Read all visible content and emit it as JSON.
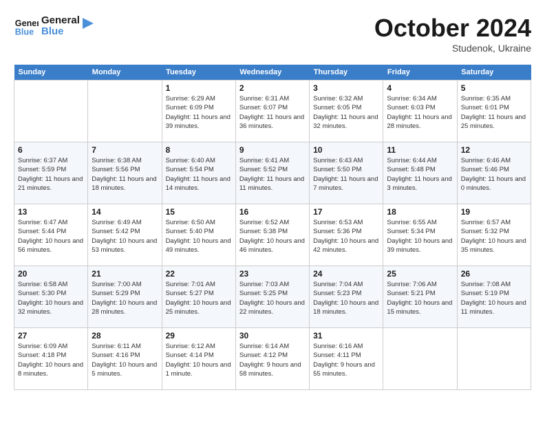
{
  "header": {
    "logo": "GeneralBlue",
    "month": "October 2024",
    "location": "Studenok, Ukraine"
  },
  "days_of_week": [
    "Sunday",
    "Monday",
    "Tuesday",
    "Wednesday",
    "Thursday",
    "Friday",
    "Saturday"
  ],
  "weeks": [
    {
      "cells": [
        {
          "day": null,
          "content": null
        },
        {
          "day": null,
          "content": null
        },
        {
          "day": "1",
          "content": "Sunrise: 6:29 AM\nSunset: 6:09 PM\nDaylight: 11 hours and 39 minutes."
        },
        {
          "day": "2",
          "content": "Sunrise: 6:31 AM\nSunset: 6:07 PM\nDaylight: 11 hours and 36 minutes."
        },
        {
          "day": "3",
          "content": "Sunrise: 6:32 AM\nSunset: 6:05 PM\nDaylight: 11 hours and 32 minutes."
        },
        {
          "day": "4",
          "content": "Sunrise: 6:34 AM\nSunset: 6:03 PM\nDaylight: 11 hours and 28 minutes."
        },
        {
          "day": "5",
          "content": "Sunrise: 6:35 AM\nSunset: 6:01 PM\nDaylight: 11 hours and 25 minutes."
        }
      ]
    },
    {
      "cells": [
        {
          "day": "6",
          "content": "Sunrise: 6:37 AM\nSunset: 5:59 PM\nDaylight: 11 hours and 21 minutes."
        },
        {
          "day": "7",
          "content": "Sunrise: 6:38 AM\nSunset: 5:56 PM\nDaylight: 11 hours and 18 minutes."
        },
        {
          "day": "8",
          "content": "Sunrise: 6:40 AM\nSunset: 5:54 PM\nDaylight: 11 hours and 14 minutes."
        },
        {
          "day": "9",
          "content": "Sunrise: 6:41 AM\nSunset: 5:52 PM\nDaylight: 11 hours and 11 minutes."
        },
        {
          "day": "10",
          "content": "Sunrise: 6:43 AM\nSunset: 5:50 PM\nDaylight: 11 hours and 7 minutes."
        },
        {
          "day": "11",
          "content": "Sunrise: 6:44 AM\nSunset: 5:48 PM\nDaylight: 11 hours and 3 minutes."
        },
        {
          "day": "12",
          "content": "Sunrise: 6:46 AM\nSunset: 5:46 PM\nDaylight: 11 hours and 0 minutes."
        }
      ]
    },
    {
      "cells": [
        {
          "day": "13",
          "content": "Sunrise: 6:47 AM\nSunset: 5:44 PM\nDaylight: 10 hours and 56 minutes."
        },
        {
          "day": "14",
          "content": "Sunrise: 6:49 AM\nSunset: 5:42 PM\nDaylight: 10 hours and 53 minutes."
        },
        {
          "day": "15",
          "content": "Sunrise: 6:50 AM\nSunset: 5:40 PM\nDaylight: 10 hours and 49 minutes."
        },
        {
          "day": "16",
          "content": "Sunrise: 6:52 AM\nSunset: 5:38 PM\nDaylight: 10 hours and 46 minutes."
        },
        {
          "day": "17",
          "content": "Sunrise: 6:53 AM\nSunset: 5:36 PM\nDaylight: 10 hours and 42 minutes."
        },
        {
          "day": "18",
          "content": "Sunrise: 6:55 AM\nSunset: 5:34 PM\nDaylight: 10 hours and 39 minutes."
        },
        {
          "day": "19",
          "content": "Sunrise: 6:57 AM\nSunset: 5:32 PM\nDaylight: 10 hours and 35 minutes."
        }
      ]
    },
    {
      "cells": [
        {
          "day": "20",
          "content": "Sunrise: 6:58 AM\nSunset: 5:30 PM\nDaylight: 10 hours and 32 minutes."
        },
        {
          "day": "21",
          "content": "Sunrise: 7:00 AM\nSunset: 5:29 PM\nDaylight: 10 hours and 28 minutes."
        },
        {
          "day": "22",
          "content": "Sunrise: 7:01 AM\nSunset: 5:27 PM\nDaylight: 10 hours and 25 minutes."
        },
        {
          "day": "23",
          "content": "Sunrise: 7:03 AM\nSunset: 5:25 PM\nDaylight: 10 hours and 22 minutes."
        },
        {
          "day": "24",
          "content": "Sunrise: 7:04 AM\nSunset: 5:23 PM\nDaylight: 10 hours and 18 minutes."
        },
        {
          "day": "25",
          "content": "Sunrise: 7:06 AM\nSunset: 5:21 PM\nDaylight: 10 hours and 15 minutes."
        },
        {
          "day": "26",
          "content": "Sunrise: 7:08 AM\nSunset: 5:19 PM\nDaylight: 10 hours and 11 minutes."
        }
      ]
    },
    {
      "cells": [
        {
          "day": "27",
          "content": "Sunrise: 6:09 AM\nSunset: 4:18 PM\nDaylight: 10 hours and 8 minutes."
        },
        {
          "day": "28",
          "content": "Sunrise: 6:11 AM\nSunset: 4:16 PM\nDaylight: 10 hours and 5 minutes."
        },
        {
          "day": "29",
          "content": "Sunrise: 6:12 AM\nSunset: 4:14 PM\nDaylight: 10 hours and 1 minute."
        },
        {
          "day": "30",
          "content": "Sunrise: 6:14 AM\nSunset: 4:12 PM\nDaylight: 9 hours and 58 minutes."
        },
        {
          "day": "31",
          "content": "Sunrise: 6:16 AM\nSunset: 4:11 PM\nDaylight: 9 hours and 55 minutes."
        },
        {
          "day": null,
          "content": null
        },
        {
          "day": null,
          "content": null
        }
      ]
    }
  ]
}
